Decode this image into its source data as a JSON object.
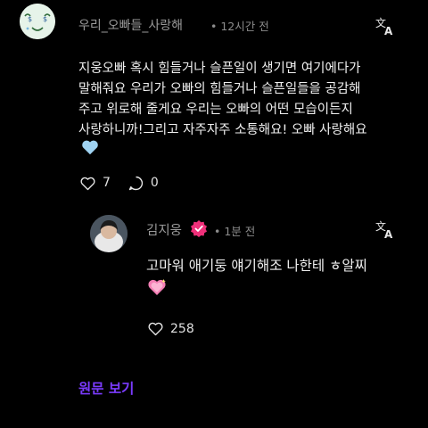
{
  "comment": {
    "username": "우리_오빠들_사랑해",
    "time": "• 12시간 전",
    "text": "지웅오빠 혹시  힘들거나 슬픈일이 생기면 여기에다가\n말해줘요 우리가 오빠의 힘들거나 슬픈일들을 공감해\n주고 위로해 줄게요 우리는 오빠의 어떤 모습이든지\n사랑하니까!그리고 자주자주 소통해요! 오빠 사랑해요",
    "emoji": "light-blue-heart",
    "likes": "7",
    "replies": "0"
  },
  "reply": {
    "username": "김지웅",
    "time": "• 1분 전",
    "text": "고마워 애기둥 얘기해조 나한테 ㅎ알찌",
    "emoji": "pink-sparkling-heart",
    "likes": "258"
  },
  "footer": {
    "view_original": "원문 보기"
  },
  "colors": {
    "background": "#000000",
    "accent": "#7b3bff",
    "verified": "#f0307a",
    "muted": "#9a9a9a"
  }
}
